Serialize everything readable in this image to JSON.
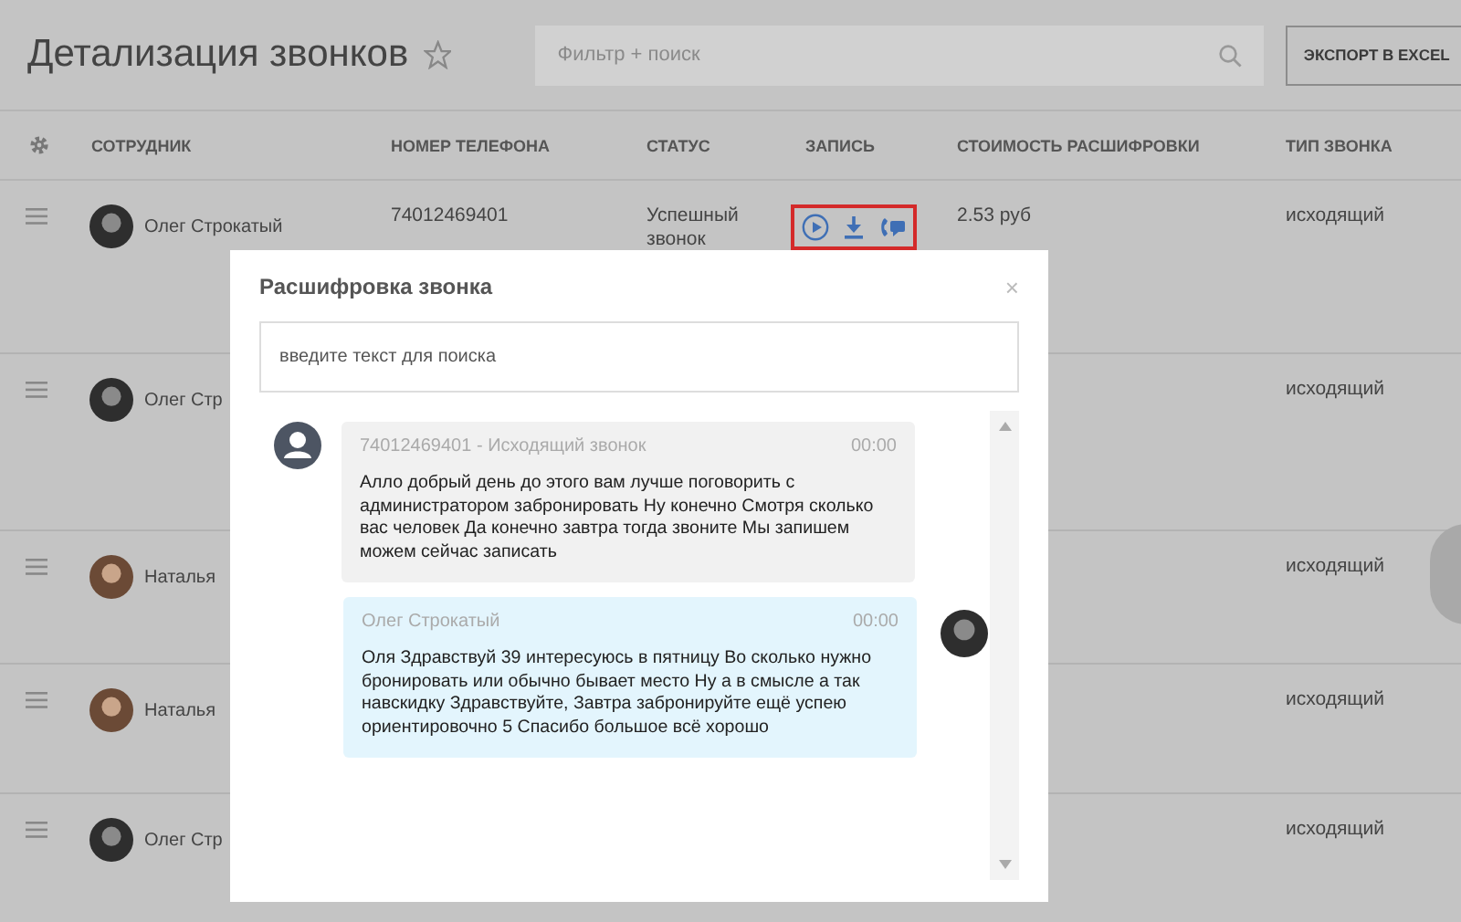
{
  "page": {
    "title": "Детализация звонков",
    "filter_placeholder": "Фильтр + поиск",
    "export_button": "ЭКСПОРТ В EXCEL"
  },
  "table": {
    "columns": [
      "СОТРУДНИК",
      "НОМЕР ТЕЛЕФОНА",
      "СТАТУС",
      "ЗАПИСЬ",
      "СТОИМОСТЬ РАСШИФРОВКИ",
      "ТИП ЗВОНКА"
    ],
    "rows": [
      {
        "employee": "Олег Строкатый",
        "kind": "man",
        "phone": "74012469401",
        "status": "Успешный звонок",
        "record_highlighted": true,
        "cost": "2.53 руб",
        "type": "исходящий"
      },
      {
        "employee": "Олег Стр",
        "kind": "man",
        "type": "исходящий"
      },
      {
        "employee": "Наталья",
        "kind": "woman",
        "type": "исходящий"
      },
      {
        "employee": "Наталья",
        "kind": "woman",
        "type": "исходящий"
      },
      {
        "employee": "Олег Стр",
        "kind": "man",
        "type": "исходящий"
      }
    ]
  },
  "modal": {
    "title": "Расшифровка звонка",
    "close": "×",
    "search_placeholder": "введите текст для поиска",
    "messages": [
      {
        "kind": "incoming",
        "header": "74012469401 - Исходящий звонок",
        "time": "00:00",
        "text": "Алло добрый день до этого вам лучше поговорить с администратором забронировать Ну конечно Смотря сколько вас человек Да конечно завтра тогда звоните Мы запишем можем сейчас записать"
      },
      {
        "kind": "outgoing",
        "header": "Олег Строкатый",
        "time": "00:00",
        "text": "Оля Здравствуй 39 интересуюсь в пятницу Во сколько нужно бронировать или обычно бывает место Ну а в смысле а так навскидку Здравствуйте, Завтра забронируйте ещё успею ориентировочно 5 Спасибо большое всё хорошо"
      }
    ]
  }
}
